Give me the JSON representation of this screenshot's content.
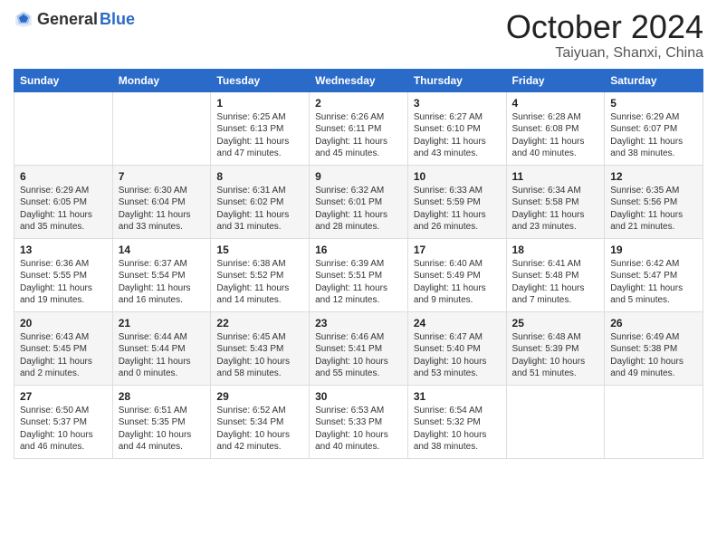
{
  "logo": {
    "general": "General",
    "blue": "Blue"
  },
  "title": {
    "month": "October 2024",
    "location": "Taiyuan, Shanxi, China"
  },
  "headers": [
    "Sunday",
    "Monday",
    "Tuesday",
    "Wednesday",
    "Thursday",
    "Friday",
    "Saturday"
  ],
  "weeks": [
    [
      {
        "day": "",
        "info": ""
      },
      {
        "day": "",
        "info": ""
      },
      {
        "day": "1",
        "info": "Sunrise: 6:25 AM\nSunset: 6:13 PM\nDaylight: 11 hours and 47 minutes."
      },
      {
        "day": "2",
        "info": "Sunrise: 6:26 AM\nSunset: 6:11 PM\nDaylight: 11 hours and 45 minutes."
      },
      {
        "day": "3",
        "info": "Sunrise: 6:27 AM\nSunset: 6:10 PM\nDaylight: 11 hours and 43 minutes."
      },
      {
        "day": "4",
        "info": "Sunrise: 6:28 AM\nSunset: 6:08 PM\nDaylight: 11 hours and 40 minutes."
      },
      {
        "day": "5",
        "info": "Sunrise: 6:29 AM\nSunset: 6:07 PM\nDaylight: 11 hours and 38 minutes."
      }
    ],
    [
      {
        "day": "6",
        "info": "Sunrise: 6:29 AM\nSunset: 6:05 PM\nDaylight: 11 hours and 35 minutes."
      },
      {
        "day": "7",
        "info": "Sunrise: 6:30 AM\nSunset: 6:04 PM\nDaylight: 11 hours and 33 minutes."
      },
      {
        "day": "8",
        "info": "Sunrise: 6:31 AM\nSunset: 6:02 PM\nDaylight: 11 hours and 31 minutes."
      },
      {
        "day": "9",
        "info": "Sunrise: 6:32 AM\nSunset: 6:01 PM\nDaylight: 11 hours and 28 minutes."
      },
      {
        "day": "10",
        "info": "Sunrise: 6:33 AM\nSunset: 5:59 PM\nDaylight: 11 hours and 26 minutes."
      },
      {
        "day": "11",
        "info": "Sunrise: 6:34 AM\nSunset: 5:58 PM\nDaylight: 11 hours and 23 minutes."
      },
      {
        "day": "12",
        "info": "Sunrise: 6:35 AM\nSunset: 5:56 PM\nDaylight: 11 hours and 21 minutes."
      }
    ],
    [
      {
        "day": "13",
        "info": "Sunrise: 6:36 AM\nSunset: 5:55 PM\nDaylight: 11 hours and 19 minutes."
      },
      {
        "day": "14",
        "info": "Sunrise: 6:37 AM\nSunset: 5:54 PM\nDaylight: 11 hours and 16 minutes."
      },
      {
        "day": "15",
        "info": "Sunrise: 6:38 AM\nSunset: 5:52 PM\nDaylight: 11 hours and 14 minutes."
      },
      {
        "day": "16",
        "info": "Sunrise: 6:39 AM\nSunset: 5:51 PM\nDaylight: 11 hours and 12 minutes."
      },
      {
        "day": "17",
        "info": "Sunrise: 6:40 AM\nSunset: 5:49 PM\nDaylight: 11 hours and 9 minutes."
      },
      {
        "day": "18",
        "info": "Sunrise: 6:41 AM\nSunset: 5:48 PM\nDaylight: 11 hours and 7 minutes."
      },
      {
        "day": "19",
        "info": "Sunrise: 6:42 AM\nSunset: 5:47 PM\nDaylight: 11 hours and 5 minutes."
      }
    ],
    [
      {
        "day": "20",
        "info": "Sunrise: 6:43 AM\nSunset: 5:45 PM\nDaylight: 11 hours and 2 minutes."
      },
      {
        "day": "21",
        "info": "Sunrise: 6:44 AM\nSunset: 5:44 PM\nDaylight: 11 hours and 0 minutes."
      },
      {
        "day": "22",
        "info": "Sunrise: 6:45 AM\nSunset: 5:43 PM\nDaylight: 10 hours and 58 minutes."
      },
      {
        "day": "23",
        "info": "Sunrise: 6:46 AM\nSunset: 5:41 PM\nDaylight: 10 hours and 55 minutes."
      },
      {
        "day": "24",
        "info": "Sunrise: 6:47 AM\nSunset: 5:40 PM\nDaylight: 10 hours and 53 minutes."
      },
      {
        "day": "25",
        "info": "Sunrise: 6:48 AM\nSunset: 5:39 PM\nDaylight: 10 hours and 51 minutes."
      },
      {
        "day": "26",
        "info": "Sunrise: 6:49 AM\nSunset: 5:38 PM\nDaylight: 10 hours and 49 minutes."
      }
    ],
    [
      {
        "day": "27",
        "info": "Sunrise: 6:50 AM\nSunset: 5:37 PM\nDaylight: 10 hours and 46 minutes."
      },
      {
        "day": "28",
        "info": "Sunrise: 6:51 AM\nSunset: 5:35 PM\nDaylight: 10 hours and 44 minutes."
      },
      {
        "day": "29",
        "info": "Sunrise: 6:52 AM\nSunset: 5:34 PM\nDaylight: 10 hours and 42 minutes."
      },
      {
        "day": "30",
        "info": "Sunrise: 6:53 AM\nSunset: 5:33 PM\nDaylight: 10 hours and 40 minutes."
      },
      {
        "day": "31",
        "info": "Sunrise: 6:54 AM\nSunset: 5:32 PM\nDaylight: 10 hours and 38 minutes."
      },
      {
        "day": "",
        "info": ""
      },
      {
        "day": "",
        "info": ""
      }
    ]
  ]
}
